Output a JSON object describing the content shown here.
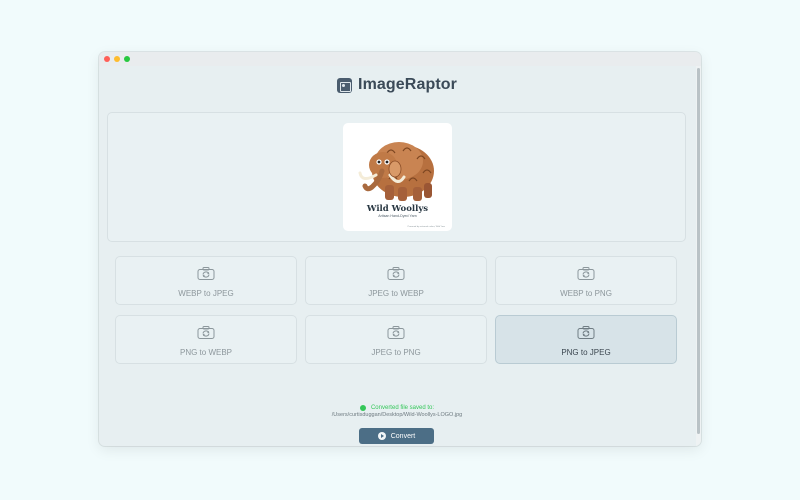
{
  "app": {
    "title": "ImageRaptor"
  },
  "preview": {
    "logo_text": "Wild Woollys",
    "logo_subtitle": "Artisan Hand-Dyed Yarn",
    "logo_footer": "Powered by artisanal colour, Wild Yarn"
  },
  "conversions": [
    {
      "label": "WEBP to JPEG",
      "icon": "convert-icon",
      "selected": false
    },
    {
      "label": "JPEG to WEBP",
      "icon": "convert-icon",
      "selected": false
    },
    {
      "label": "WEBP to PNG",
      "icon": "convert-icon",
      "selected": false
    },
    {
      "label": "PNG to WEBP",
      "icon": "convert-icon",
      "selected": false
    },
    {
      "label": "JPEG to PNG",
      "icon": "convert-icon",
      "selected": false
    },
    {
      "label": "PNG to JPEG",
      "icon": "convert-icon",
      "selected": true
    }
  ],
  "status": {
    "message": "Converted file saved to:",
    "path": "/Users/curtisduggan/Desktop/Wild-Woollys-LOGO.jpg"
  },
  "actions": {
    "convert_label": "Convert"
  },
  "colors": {
    "accent": "#4c6e86",
    "success": "#34c759",
    "selected_card": "#d7e3e8"
  }
}
